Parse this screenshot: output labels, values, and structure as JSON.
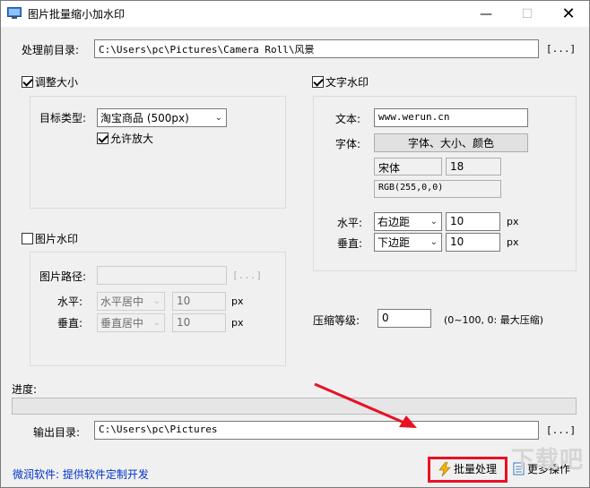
{
  "window": {
    "title": "图片批量缩小加水印",
    "minimize_icon": "minimize-icon",
    "maximize_icon": "maximize-icon",
    "close_icon": "close-icon"
  },
  "source": {
    "label": "处理前目录:",
    "value": "C:\\Users\\pc\\Pictures\\Camera Roll\\风景",
    "browse": "[...]"
  },
  "resize": {
    "enabled_label": "调整大小",
    "enabled": true,
    "target_type_label": "目标类型:",
    "target_type_value": "淘宝商品 (500px)",
    "allow_enlarge_label": "允许放大",
    "allow_enlarge": true
  },
  "image_watermark": {
    "enabled_label": "图片水印",
    "enabled": false,
    "path_label": "图片路径:",
    "path_value": "",
    "browse": "[...]",
    "horizontal_label": "水平:",
    "horizontal_value": "水平居中",
    "horizontal_offset": "10",
    "vertical_label": "垂直:",
    "vertical_value": "垂直居中",
    "vertical_offset": "10",
    "unit": "px"
  },
  "text_watermark": {
    "enabled_label": "文字水印",
    "enabled": true,
    "text_label": "文本:",
    "text_value": "www.werun.cn",
    "font_label": "字体:",
    "font_button": "字体、大小、颜色",
    "font_name": "宋体",
    "font_size": "18",
    "font_color": "RGB(255,0,0)",
    "horizontal_label": "水平:",
    "horizontal_value": "右边距",
    "horizontal_offset": "10",
    "vertical_label": "垂直:",
    "vertical_value": "下边距",
    "vertical_offset": "10",
    "unit": "px"
  },
  "compression": {
    "label": "压缩等级:",
    "value": "0",
    "hint": "(0~100, 0: 最大压缩)"
  },
  "progress": {
    "label": "进度:",
    "value": 0
  },
  "output": {
    "label": "输出目录:",
    "value": "C:\\Users\\pc\\Pictures",
    "browse": "[...]"
  },
  "footer": {
    "link": "微润软件: 提供软件定制开发",
    "batch_button": "批量处理",
    "batch_icon": "lightning-icon",
    "more_button": "更多操作",
    "more_icon": "document-icon",
    "highlight_color": "#e81123"
  },
  "watermark_logo": "下载吧"
}
